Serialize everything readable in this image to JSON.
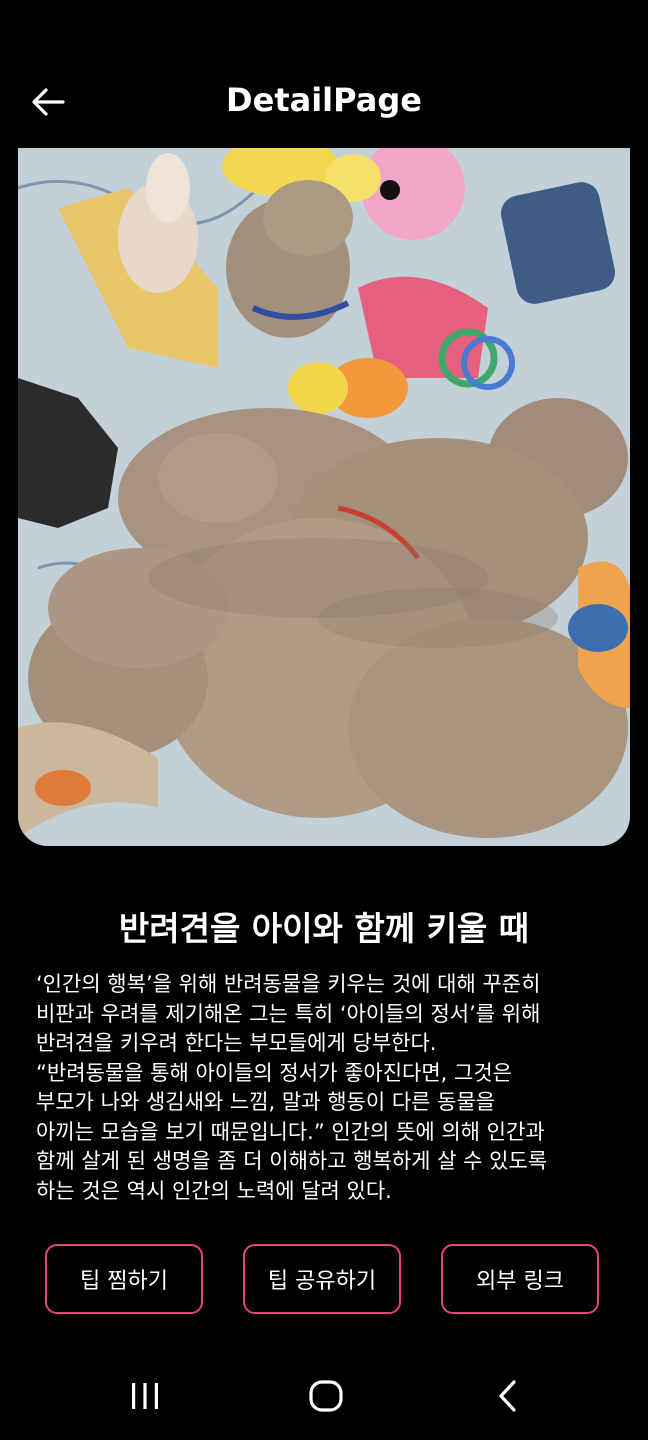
{
  "header": {
    "title": "DetailPage",
    "back_icon": "arrow-left-icon"
  },
  "photo": {
    "subject": "puppies-photo"
  },
  "tip": {
    "title": "반려견을 아이와 함께 키울 때",
    "body": "‘인간의 행복’을 위해 반려동물을 키우는 것에 대해 꾸준히\n비판과 우려를 제기해온 그는 특히 ‘아이들의 정서’를 위해\n반려견을 키우려 한다는 부모들에게 당부한다.\n“반려동물을 통해 아이들의 정서가 좋아진다면, 그것은\n부모가 나와 생김새와 느낌, 말과 행동이 다른 동물을\n아끼는 모습을 보기 때문입니다.” 인간의 뜻에 의해 인간과\n함께 살게 된 생명을 좀 더 이해하고 행복하게 살 수 있도록\n하는 것은 역시 인간의 노력에 달려 있다."
  },
  "actions": {
    "save_label": "팁 찜하기",
    "share_label": "팁 공유하기",
    "link_label": "외부 링크",
    "border_color": "#e0467c"
  },
  "navbar": {
    "recent_icon": "recent-apps-icon",
    "home_icon": "home-icon",
    "back_icon": "chevron-left-icon"
  }
}
